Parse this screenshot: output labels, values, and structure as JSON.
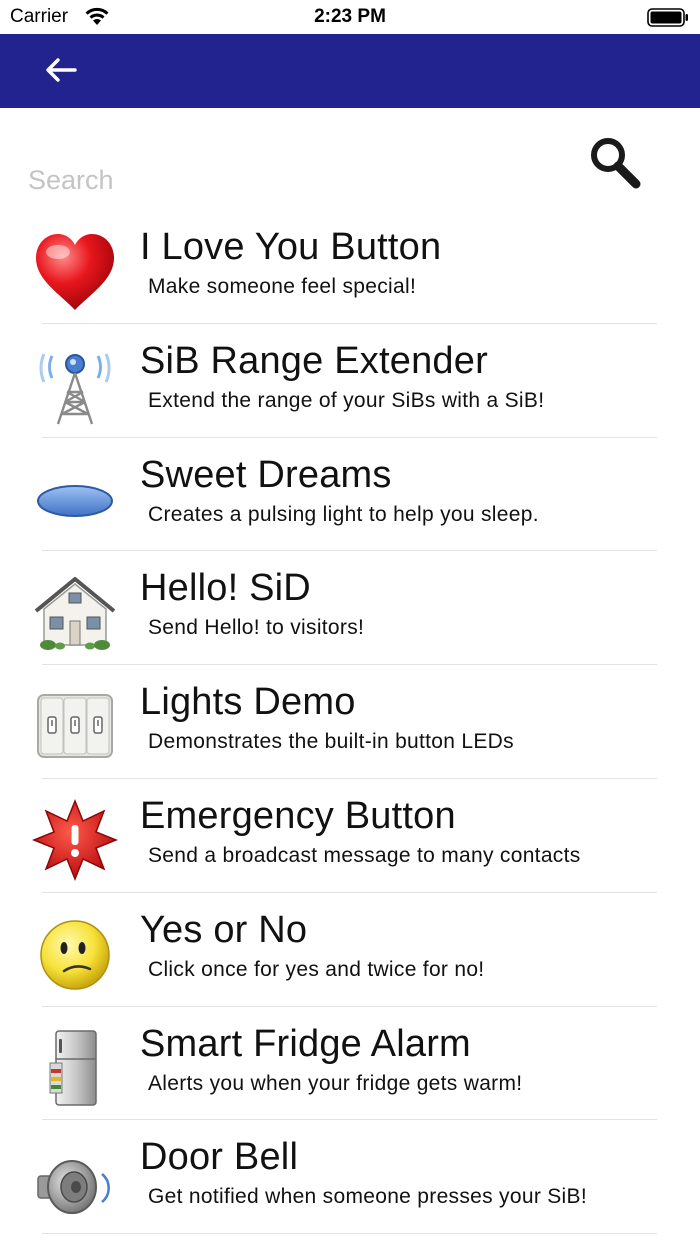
{
  "status_bar": {
    "carrier": "Carrier",
    "time": "2:23 PM"
  },
  "nav": {
    "back_icon": "back-arrow-icon",
    "color": "#23238f"
  },
  "search": {
    "placeholder": "Search",
    "value": "",
    "icon": "search-icon"
  },
  "items": [
    {
      "title": "I Love You Button",
      "subtitle": "Make someone feel special!",
      "icon": "heart-icon"
    },
    {
      "title": "SiB Range Extender",
      "subtitle": "Extend the range of your SiBs with a SiB!",
      "icon": "antenna-tower-icon"
    },
    {
      "title": "Sweet Dreams",
      "subtitle": "Creates a pulsing light to help you sleep.",
      "icon": "blue-oval-light-icon"
    },
    {
      "title": "Hello! SiD",
      "subtitle": "Send Hello! to visitors!",
      "icon": "house-icon"
    },
    {
      "title": "Lights Demo",
      "subtitle": "Demonstrates the built-in button LEDs",
      "icon": "light-switches-icon"
    },
    {
      "title": "Emergency Button",
      "subtitle": "Send a broadcast message to many contacts",
      "icon": "emergency-star-icon"
    },
    {
      "title": "Yes or No",
      "subtitle": "Click once for yes and twice for no!",
      "icon": "confused-face-icon"
    },
    {
      "title": "Smart Fridge Alarm",
      "subtitle": "Alerts you when your fridge gets warm!",
      "icon": "fridge-icon"
    },
    {
      "title": "Door Bell",
      "subtitle": "Get notified when someone presses your SiB!",
      "icon": "speaker-icon"
    }
  ]
}
